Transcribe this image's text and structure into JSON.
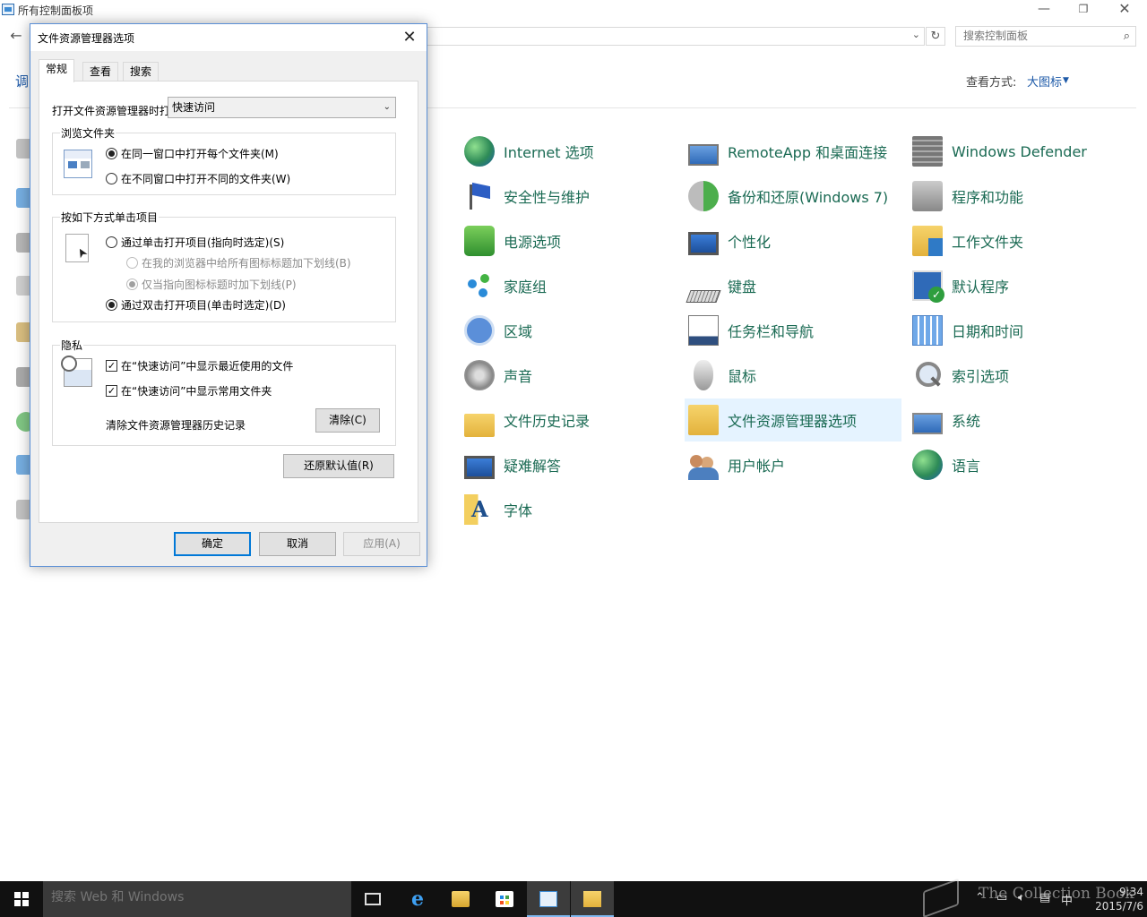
{
  "control_panel": {
    "title": "所有控制面板项",
    "search_placeholder": "搜索控制面板",
    "heading_partial": "调",
    "view_by_label": "查看方式:",
    "view_by_value": "大图标",
    "items": [
      {
        "label": "Internet 选项",
        "icon": "globe-icon"
      },
      {
        "label": "RemoteApp 和桌面连接",
        "icon": "remote-desktop-icon"
      },
      {
        "label": "Windows Defender",
        "icon": "defender-wall-icon"
      },
      {
        "label": "安全性与维护",
        "icon": "security-flag-icon"
      },
      {
        "label": "备份和还原(Windows 7)",
        "icon": "backup-icon"
      },
      {
        "label": "程序和功能",
        "icon": "programs-icon"
      },
      {
        "label": "电源选项",
        "icon": "power-icon"
      },
      {
        "label": "个性化",
        "icon": "personalization-icon"
      },
      {
        "label": "工作文件夹",
        "icon": "work-folders-icon"
      },
      {
        "label": "家庭组",
        "icon": "homegroup-icon"
      },
      {
        "label": "键盘",
        "icon": "keyboard-icon"
      },
      {
        "label": "默认程序",
        "icon": "default-programs-icon"
      },
      {
        "label": "区域",
        "icon": "region-icon"
      },
      {
        "label": "任务栏和导航",
        "icon": "taskbar-icon"
      },
      {
        "label": "日期和时间",
        "icon": "calendar-icon"
      },
      {
        "label": "声音",
        "icon": "speaker-icon"
      },
      {
        "label": "鼠标",
        "icon": "mouse-icon"
      },
      {
        "label": "索引选项",
        "icon": "indexing-icon"
      },
      {
        "label": "文件历史记录",
        "icon": "file-history-icon"
      },
      {
        "label": "文件资源管理器选项",
        "icon": "folder-options-icon"
      },
      {
        "label": "系统",
        "icon": "system-icon"
      },
      {
        "label": "疑难解答",
        "icon": "troubleshoot-icon"
      },
      {
        "label": "用户帐户",
        "icon": "user-accounts-icon"
      },
      {
        "label": "语言",
        "icon": "language-icon"
      },
      {
        "label": "字体",
        "icon": "fonts-icon"
      }
    ],
    "selected_item": "文件资源管理器选项"
  },
  "dialog": {
    "title": "文件资源管理器选项",
    "tabs": [
      "常规",
      "查看",
      "搜索"
    ],
    "active_tab": "常规",
    "open_label": "打开文件资源管理器时打",
    "open_value": "快速访问",
    "browse_group": {
      "title": "浏览文件夹",
      "options": [
        "在同一窗口中打开每个文件夹(M)",
        "在不同窗口中打开不同的文件夹(W)"
      ],
      "selected": "在同一窗口中打开每个文件夹(M)"
    },
    "click_group": {
      "title": "按如下方式单击项目",
      "single_click": "通过单击打开项目(指向时选定)(S)",
      "underline_always": "在我的浏览器中给所有图标标题加下划线(B)",
      "underline_hover": "仅当指向图标标题时加下划线(P)",
      "double_click": "通过双击打开项目(单击时选定)(D)",
      "selected": "通过双击打开项目(单击时选定)(D)"
    },
    "privacy_group": {
      "title": "隐私",
      "show_recent": "在“快速访问”中显示最近使用的文件",
      "show_frequent": "在“快速访问”中显示常用文件夹",
      "show_recent_checked": true,
      "show_frequent_checked": true,
      "clear_history_label": "清除文件资源管理器历史记录",
      "clear_button": "清除(C)"
    },
    "restore_defaults_button": "还原默认值(R)",
    "ok_button": "确定",
    "cancel_button": "取消",
    "apply_button": "应用(A)"
  },
  "taskbar": {
    "search_placeholder": "搜索 Web 和 Windows",
    "edge_glyph": "e",
    "time": "9:34",
    "date": "2015/7/6",
    "ime": "中",
    "watermark": "The Collection Book"
  }
}
